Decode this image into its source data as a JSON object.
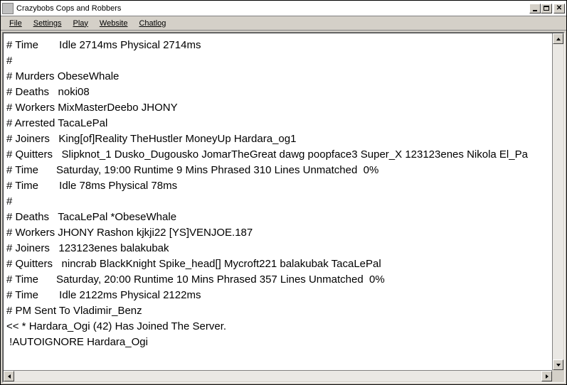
{
  "window": {
    "title": "Crazybobs Cops and Robbers"
  },
  "menu": {
    "items": [
      "File",
      "Settings",
      "Play",
      "Website",
      "Chatlog"
    ]
  },
  "log": {
    "lines": [
      "# Time       Idle 2714ms Physical 2714ms",
      "#",
      "# Murders ObeseWhale",
      "# Deaths   noki08",
      "# Workers MixMasterDeebo JHONY",
      "# Arrested TacaLePal",
      "# Joiners   King[of]Reality TheHustler MoneyUp Hardara_og1",
      "# Quitters   Slipknot_1 Dusko_Dugousko JomarTheGreat dawg poopface3 Super_X 123123enes Nikola El_Pa",
      "# Time      Saturday, 19:00 Runtime 9 Mins Phrased 310 Lines Unmatched  0%",
      "# Time       Idle 78ms Physical 78ms",
      "#",
      "# Deaths   TacaLePal *ObeseWhale",
      "# Workers JHONY Rashon kjkji22 [YS]VENJOE.187",
      "# Joiners   123123enes balakubak",
      "# Quitters   nincrab BlackKnight Spike_head[] Mycroft221 balakubak TacaLePal",
      "# Time      Saturday, 20:00 Runtime 10 Mins Phrased 357 Lines Unmatched  0%",
      "# Time       Idle 2122ms Physical 2122ms",
      "# PM Sent To Vladimir_Benz",
      "<< * Hardara_Ogi (42) Has Joined The Server.",
      " !AUTOIGNORE Hardara_Ogi"
    ]
  }
}
